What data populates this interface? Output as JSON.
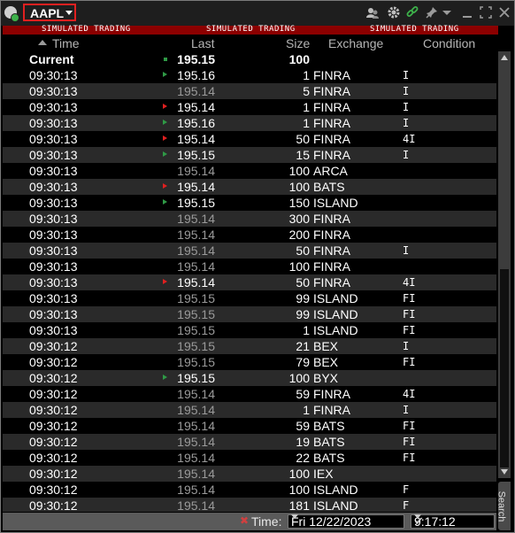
{
  "title_bar": {
    "symbol": "AAPL",
    "icons": [
      "app-icon",
      "users-icon",
      "gear-icon",
      "link-icon",
      "pin-icon",
      "menu-caret-icon",
      "minimize-icon",
      "maximize-icon",
      "close-icon"
    ],
    "link_color": "#3db04a"
  },
  "banner": {
    "text": [
      "SIMULATED TRADING",
      "SIMULATED TRADING",
      "SIMULATED TRADING"
    ],
    "color": "#8c0000"
  },
  "columns": [
    "Time",
    "Last",
    "Size",
    "Exchange",
    "Condition"
  ],
  "current": {
    "label": "Current",
    "last": "195.15",
    "size": "100"
  },
  "rows": [
    {
      "time": "09:30:13",
      "last": "195.16",
      "size": "1",
      "exchange": "FINRA",
      "condition": "I",
      "tick": "up"
    },
    {
      "time": "09:30:13",
      "last": "195.14",
      "size": "5",
      "exchange": "FINRA",
      "condition": "I",
      "tick": ""
    },
    {
      "time": "09:30:13",
      "last": "195.14",
      "size": "1",
      "exchange": "FINRA",
      "condition": "I",
      "tick": "down"
    },
    {
      "time": "09:30:13",
      "last": "195.16",
      "size": "1",
      "exchange": "FINRA",
      "condition": "I",
      "tick": "up"
    },
    {
      "time": "09:30:13",
      "last": "195.14",
      "size": "50",
      "exchange": "FINRA",
      "condition": "4I",
      "tick": "down"
    },
    {
      "time": "09:30:13",
      "last": "195.15",
      "size": "15",
      "exchange": "FINRA",
      "condition": "I",
      "tick": "up"
    },
    {
      "time": "09:30:13",
      "last": "195.14",
      "size": "100",
      "exchange": "ARCA",
      "condition": "",
      "tick": ""
    },
    {
      "time": "09:30:13",
      "last": "195.14",
      "size": "100",
      "exchange": "BATS",
      "condition": "",
      "tick": "down"
    },
    {
      "time": "09:30:13",
      "last": "195.15",
      "size": "150",
      "exchange": "ISLAND",
      "condition": "",
      "tick": "up"
    },
    {
      "time": "09:30:13",
      "last": "195.14",
      "size": "300",
      "exchange": "FINRA",
      "condition": "",
      "tick": ""
    },
    {
      "time": "09:30:13",
      "last": "195.14",
      "size": "200",
      "exchange": "FINRA",
      "condition": "",
      "tick": ""
    },
    {
      "time": "09:30:13",
      "last": "195.14",
      "size": "50",
      "exchange": "FINRA",
      "condition": "I",
      "tick": ""
    },
    {
      "time": "09:30:13",
      "last": "195.14",
      "size": "100",
      "exchange": "FINRA",
      "condition": "",
      "tick": ""
    },
    {
      "time": "09:30:13",
      "last": "195.14",
      "size": "50",
      "exchange": "FINRA",
      "condition": "4I",
      "tick": "down"
    },
    {
      "time": "09:30:13",
      "last": "195.15",
      "size": "99",
      "exchange": "ISLAND",
      "condition": "FI",
      "tick": ""
    },
    {
      "time": "09:30:13",
      "last": "195.15",
      "size": "99",
      "exchange": "ISLAND",
      "condition": "FI",
      "tick": ""
    },
    {
      "time": "09:30:13",
      "last": "195.15",
      "size": "1",
      "exchange": "ISLAND",
      "condition": "FI",
      "tick": ""
    },
    {
      "time": "09:30:12",
      "last": "195.15",
      "size": "21",
      "exchange": "BEX",
      "condition": "I",
      "tick": ""
    },
    {
      "time": "09:30:12",
      "last": "195.15",
      "size": "79",
      "exchange": "BEX",
      "condition": "FI",
      "tick": ""
    },
    {
      "time": "09:30:12",
      "last": "195.15",
      "size": "100",
      "exchange": "BYX",
      "condition": "",
      "tick": "up"
    },
    {
      "time": "09:30:12",
      "last": "195.14",
      "size": "59",
      "exchange": "FINRA",
      "condition": "4I",
      "tick": ""
    },
    {
      "time": "09:30:12",
      "last": "195.14",
      "size": "1",
      "exchange": "FINRA",
      "condition": "I",
      "tick": ""
    },
    {
      "time": "09:30:12",
      "last": "195.14",
      "size": "59",
      "exchange": "BATS",
      "condition": "FI",
      "tick": ""
    },
    {
      "time": "09:30:12",
      "last": "195.14",
      "size": "19",
      "exchange": "BATS",
      "condition": "FI",
      "tick": ""
    },
    {
      "time": "09:30:12",
      "last": "195.14",
      "size": "22",
      "exchange": "BATS",
      "condition": "FI",
      "tick": ""
    },
    {
      "time": "09:30:12",
      "last": "195.14",
      "size": "100",
      "exchange": "IEX",
      "condition": "",
      "tick": ""
    },
    {
      "time": "09:30:12",
      "last": "195.14",
      "size": "100",
      "exchange": "ISLAND",
      "condition": "F",
      "tick": ""
    },
    {
      "time": "09:30:12",
      "last": "195.14",
      "size": "181",
      "exchange": "ISLAND",
      "condition": "F",
      "tick": ""
    }
  ],
  "side_tab": {
    "label": "Search"
  },
  "footer": {
    "label": "Time:",
    "date_value": "Fri 12/22/2023",
    "time_value": "9:17:12"
  }
}
